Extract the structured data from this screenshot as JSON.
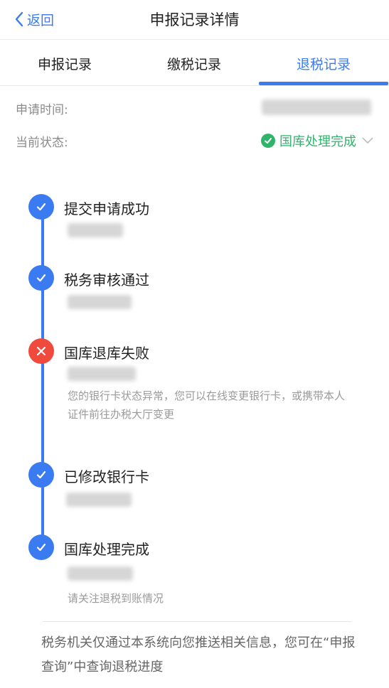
{
  "header": {
    "back_label": "返回",
    "title": "申报记录详情"
  },
  "tabs": [
    {
      "label": "申报记录",
      "active": false
    },
    {
      "label": "缴税记录",
      "active": false
    },
    {
      "label": "退税记录",
      "active": true
    }
  ],
  "info": {
    "apply_time_label": "申请时间:",
    "status_label": "当前状态:",
    "status_value": "国库处理完成"
  },
  "steps": [
    {
      "title": "提交申请成功",
      "state": "ok"
    },
    {
      "title": "税务审核通过",
      "state": "ok"
    },
    {
      "title": "国库退库失败",
      "state": "fail",
      "note": "您的银行卡状态异常，您可以在线变更银行卡，或携带本人证件前往办税大厅变更"
    },
    {
      "title": "已修改银行卡",
      "state": "ok"
    },
    {
      "title": "国库处理完成",
      "state": "ok",
      "note": "请关注退税到账情况"
    }
  ],
  "footer": {
    "notice": "税务机关仅通过本系统向您推送相关信息，您可在“申报查询”中查询退税进度"
  },
  "colors": {
    "accent": "#3a7bf2",
    "success": "#2fb56b",
    "error": "#ef4a3c"
  }
}
